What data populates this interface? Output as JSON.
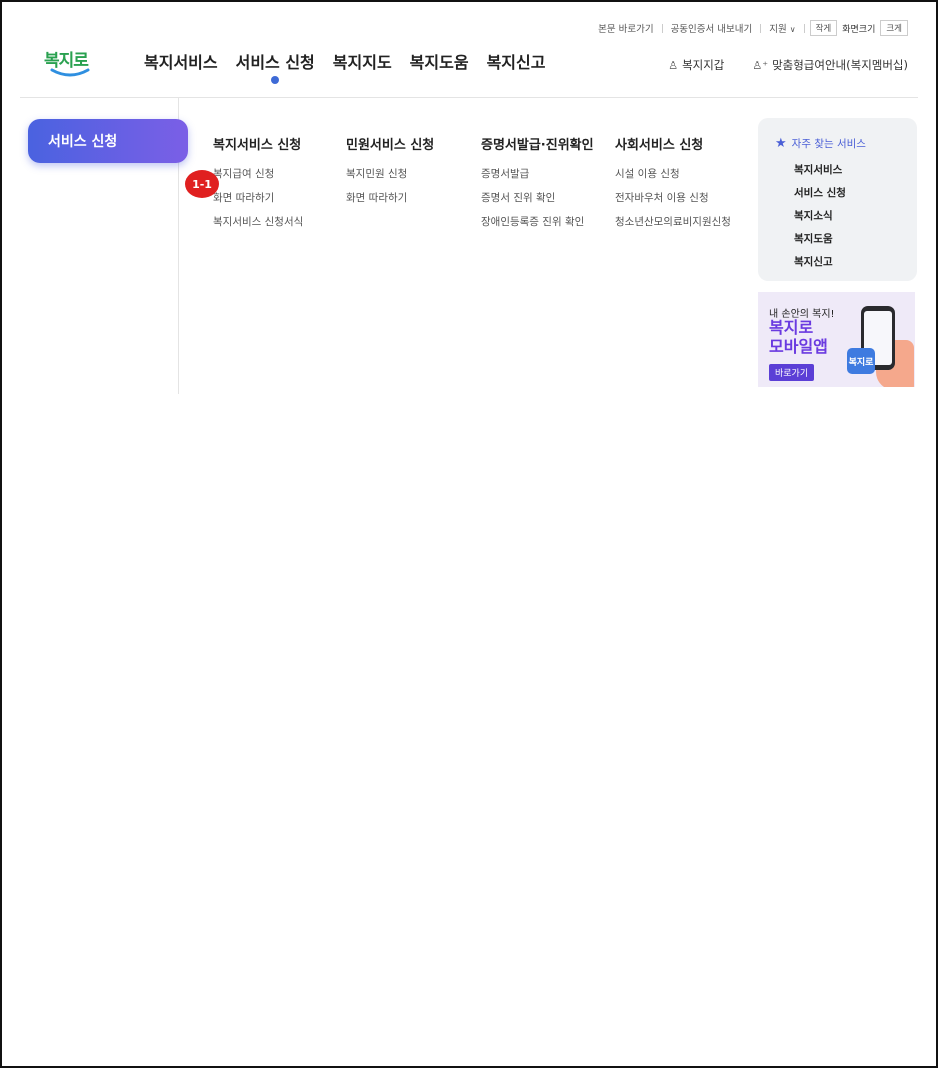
{
  "utility_bar": {
    "skip_to_content": "본문 바로가기",
    "export_certificate": "공동인증서 내보내기",
    "support": "지원",
    "font_small": "작게",
    "screen_size": "화면크기",
    "font_large": "크게"
  },
  "header": {
    "logo_text": "복지로",
    "nav": [
      {
        "label": "복지서비스"
      },
      {
        "label": "서비스 신청"
      },
      {
        "label": "복지지도"
      },
      {
        "label": "복지도움"
      },
      {
        "label": "복지신고"
      }
    ],
    "wallet": "복지지갑",
    "membership": "맞춤형급여안내(복지멤버십)"
  },
  "mega_menu": {
    "side_tab": "서비스 신청",
    "columns": [
      {
        "heading": "복지서비스 신청",
        "links": [
          "복지급여 신청",
          "화면 따라하기",
          "복지서비스 신청서식"
        ]
      },
      {
        "heading": "민원서비스 신청",
        "links": [
          "복지민원 신청",
          "화면 따라하기"
        ]
      },
      {
        "heading": "증명서발급·진위확인",
        "links": [
          "증명서발급",
          "증명서 진위 확인",
          "장애인등록증 진위 확인"
        ]
      },
      {
        "heading": "사회서비스 신청",
        "links": [
          "시설 이용 신청",
          "전자바우처 이용 신청",
          "청소년산모의료비지원신청"
        ]
      }
    ],
    "annotation_badge": "1-1"
  },
  "frequent_services": {
    "title": "자주 찾는 서비스",
    "items": [
      "복지서비스",
      "서비스 신청",
      "복지소식",
      "복지도움",
      "복지신고"
    ]
  },
  "app_banner": {
    "line1": "내 손안의 복지!",
    "line2": "복지로",
    "line3": "모바일앱",
    "button": "바로가기",
    "app_icon_text": "복지로"
  },
  "colors": {
    "accent_blue": "#4a62e0",
    "accent_purple": "#6a3ae0",
    "logo_green": "#2aa150",
    "badge_red": "#e02020"
  }
}
